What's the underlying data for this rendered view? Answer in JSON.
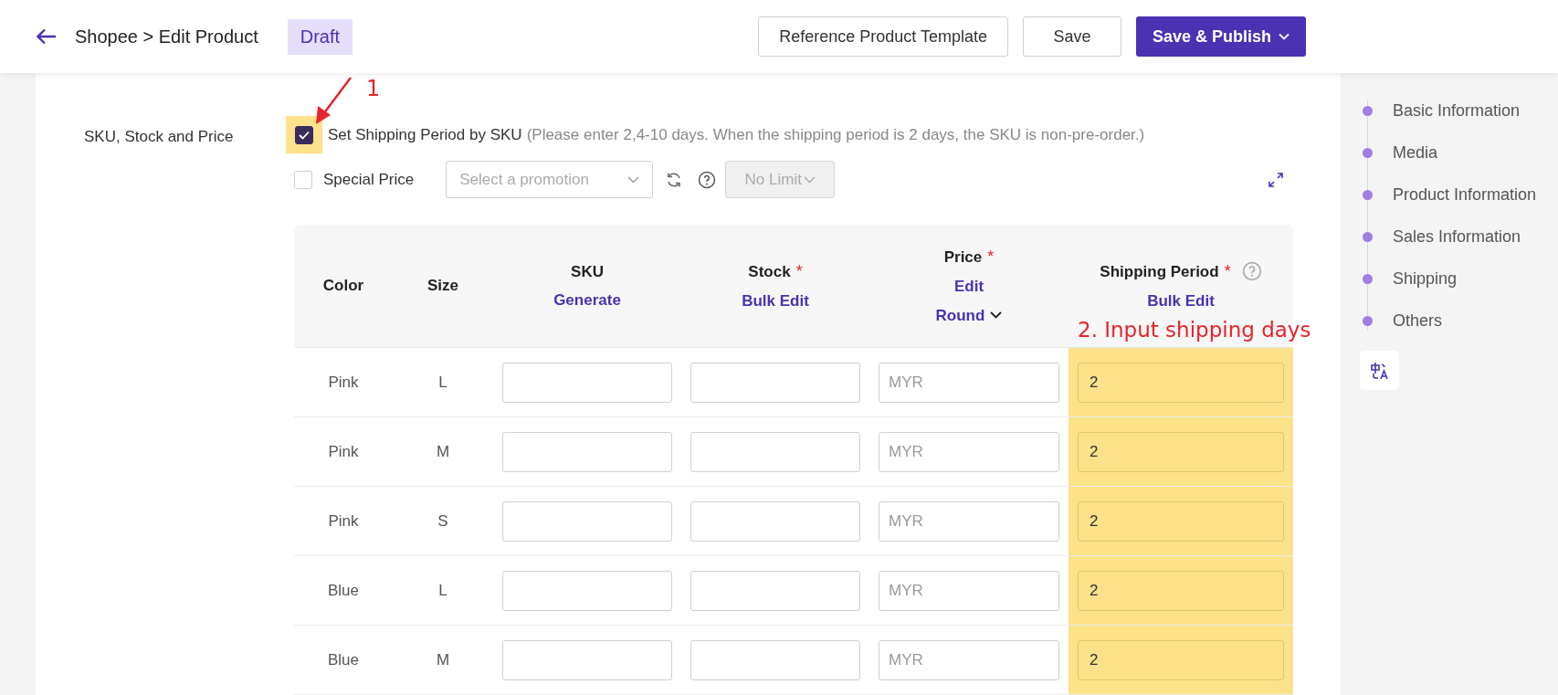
{
  "header": {
    "title": "Shopee > Edit Product",
    "status": "Draft",
    "buttons": [
      {
        "label": "Reference Product Template",
        "kind": "outline"
      },
      {
        "label": "Save",
        "kind": "outline"
      },
      {
        "label": "Save & Publish",
        "kind": "primary"
      }
    ]
  },
  "section": {
    "label": "SKU, Stock and Price",
    "shipping_by_sku": {
      "label": "Set Shipping Period by SKU",
      "hint": "(Please enter 2,4-10 days. When the shipping period is 2 days, the SKU is non-pre-order.)",
      "checked": true,
      "highlighted": true
    },
    "special_price": {
      "label": "Special Price",
      "checked": false,
      "promotion_placeholder": "Select a promotion",
      "limit": "No Limit",
      "limit_disabled": true
    },
    "table": {
      "columns": [
        {
          "title": "Color"
        },
        {
          "title": "Size"
        },
        {
          "title": "SKU",
          "action": "Generate"
        },
        {
          "title": "Stock",
          "required_mark": "*",
          "action": "Bulk Edit"
        },
        {
          "title": "Price",
          "required_mark": "*",
          "action": "Edit",
          "menu": "Round"
        },
        {
          "title": "Shipping Period",
          "required_mark": "*",
          "help": true,
          "action": "Bulk Edit",
          "highlighted": true
        }
      ],
      "rows": [
        {
          "variant_color": "Pink",
          "size": "L",
          "price_placeholder": "MYR",
          "shipping_period": "2"
        },
        {
          "variant_color": "Pink",
          "size": "M",
          "price_placeholder": "MYR",
          "shipping_period": "2"
        },
        {
          "variant_color": "Pink",
          "size": "S",
          "price_placeholder": "MYR",
          "shipping_period": "2"
        },
        {
          "variant_color": "Blue",
          "size": "L",
          "price_placeholder": "MYR",
          "shipping_period": "2"
        },
        {
          "variant_color": "Blue",
          "size": "M",
          "price_placeholder": "MYR",
          "shipping_period": "2"
        }
      ]
    }
  },
  "annotations": [
    {
      "kind": "arrow",
      "label": "1"
    },
    {
      "kind": "note",
      "label": "2. Input shipping days"
    }
  ],
  "nav": {
    "items": [
      {
        "label": "Basic Information"
      },
      {
        "label": "Media"
      },
      {
        "label": "Product Information"
      },
      {
        "label": "Sales Information"
      },
      {
        "label": "Shipping"
      },
      {
        "label": "Others"
      }
    ]
  }
}
